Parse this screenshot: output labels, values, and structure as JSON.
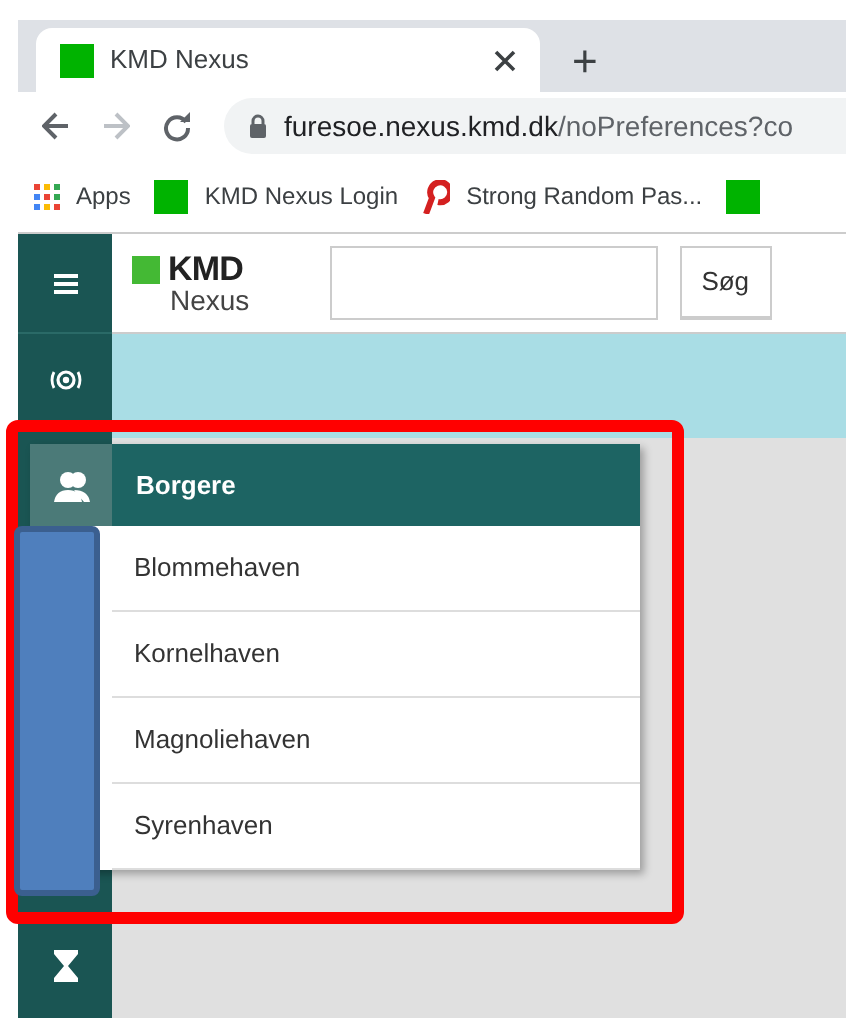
{
  "browser": {
    "tab": {
      "title": "KMD Nexus"
    },
    "new_tab": "+",
    "address": {
      "host": "furesoe.nexus.kmd.dk",
      "path": "/noPreferences?co"
    },
    "bookmarks": [
      {
        "kind": "apps",
        "label": "Apps"
      },
      {
        "kind": "green",
        "label": "KMD Nexus Login"
      },
      {
        "kind": "red",
        "label": "Strong Random Pas..."
      },
      {
        "kind": "green"
      }
    ]
  },
  "app": {
    "logo": {
      "brand": "KMD",
      "product": "Nexus"
    },
    "search": {
      "button": "Søg"
    },
    "menu": {
      "title": "Borgere",
      "items": [
        {
          "label": "Blommehaven"
        },
        {
          "label": "Kornelhaven"
        },
        {
          "label": "Magnoliehaven"
        },
        {
          "label": "Syrenhaven"
        }
      ]
    }
  }
}
